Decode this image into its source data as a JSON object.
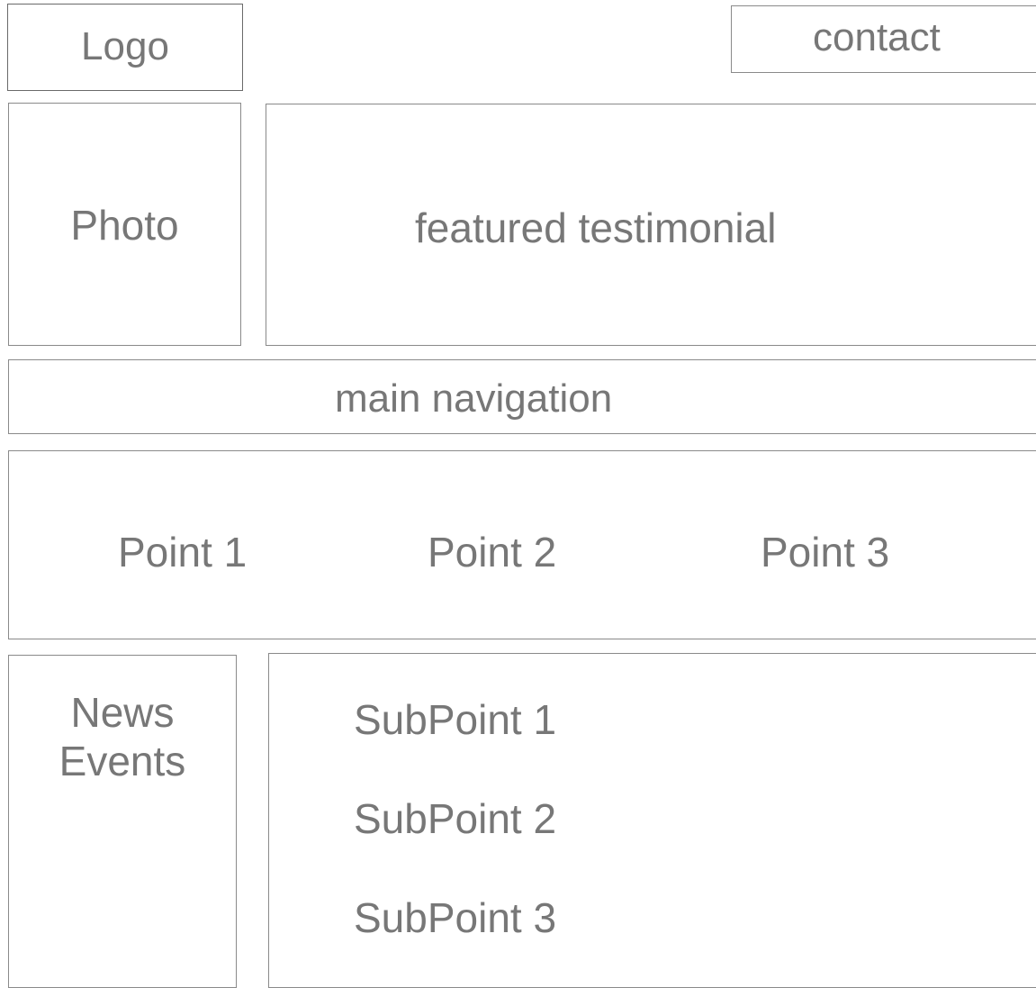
{
  "header": {
    "logo": "Logo",
    "contact": "contact"
  },
  "hero": {
    "photo": "Photo",
    "testimonial": "featured testimonial"
  },
  "navigation": {
    "label": "main navigation"
  },
  "points": [
    "Point 1",
    "Point 2",
    "Point 3"
  ],
  "sidebar": {
    "lines": [
      "News",
      "Events"
    ]
  },
  "subpoints": [
    "SubPoint 1",
    "SubPoint 2",
    "SubPoint 3"
  ],
  "colors": {
    "border": "#8a8a8a",
    "text": "#777777",
    "background": "#ffffff"
  }
}
